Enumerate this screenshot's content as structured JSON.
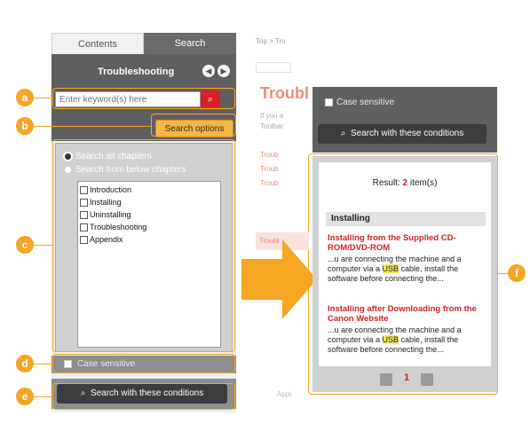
{
  "left": {
    "tabs": {
      "contents": "Contents",
      "search": "Search"
    },
    "title": "Troubleshooting",
    "keyword_placeholder": "Enter keyword(s) here",
    "search_options": "Search options",
    "radio_all": "Search all chapters",
    "radio_below": "Search from below chapters",
    "chapters": [
      "Introduction",
      "Installing",
      "Uninstalling",
      "Troubleshooting",
      "Appendix"
    ],
    "case_sensitive": "Case sensitive",
    "search_button": "Search with these conditions"
  },
  "center": {
    "breadcrumb": "Top > Tro",
    "title": "Troubl",
    "line1": "If you a",
    "line2": "Toolbar",
    "items": [
      "Troub",
      "Troub",
      "Troub"
    ],
    "tag": "Troubl",
    "bottom": "Appl"
  },
  "right": {
    "case_sensitive": "Case sensitive",
    "search_button": "Search with these conditions",
    "result_prefix": "Result:",
    "result_count": "2",
    "result_suffix": "item(s)",
    "group": "Installing",
    "results": [
      {
        "title": "Installing from the Supplied CD-ROM/DVD-ROM",
        "snippet_before": "...u are connecting the machine and a computer via a ",
        "highlight": "USB",
        "snippet_after": " cable, install the software before connecting the..."
      },
      {
        "title": "Installing after Downloading from the Canon Website",
        "snippet_before": "...u are connecting the machine and a computer via a ",
        "highlight": "USB",
        "snippet_after": " cable, install the software before connecting the..."
      }
    ],
    "page": "1"
  },
  "callouts": [
    "a",
    "b",
    "c",
    "d",
    "e",
    "f"
  ],
  "colors": {
    "accent": "#f5a623",
    "brand_red": "#d42027",
    "panel_dark": "#5f5f5f"
  }
}
